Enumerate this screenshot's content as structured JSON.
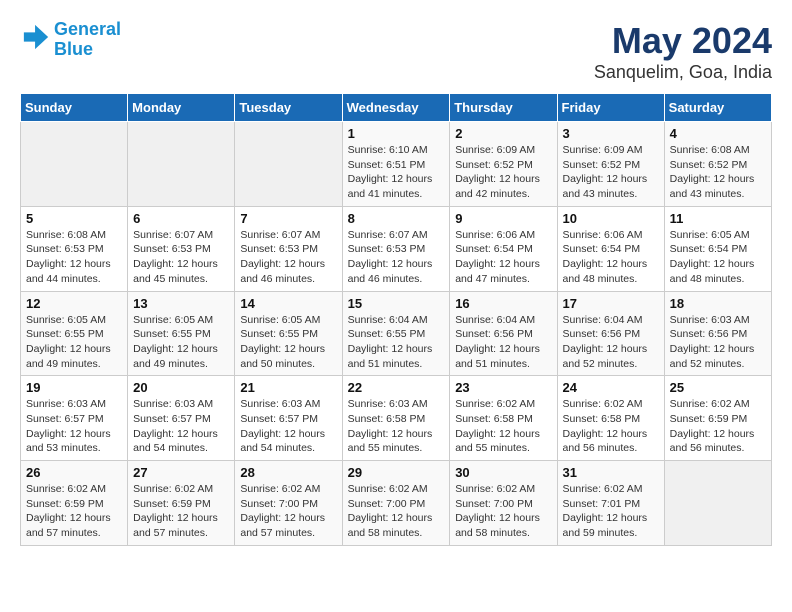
{
  "header": {
    "logo_line1": "General",
    "logo_line2": "Blue",
    "title": "May 2024",
    "subtitle": "Sanquelim, Goa, India"
  },
  "weekdays": [
    "Sunday",
    "Monday",
    "Tuesday",
    "Wednesday",
    "Thursday",
    "Friday",
    "Saturday"
  ],
  "weeks": [
    [
      {
        "day": "",
        "info": ""
      },
      {
        "day": "",
        "info": ""
      },
      {
        "day": "",
        "info": ""
      },
      {
        "day": "1",
        "info": "Sunrise: 6:10 AM\nSunset: 6:51 PM\nDaylight: 12 hours\nand 41 minutes."
      },
      {
        "day": "2",
        "info": "Sunrise: 6:09 AM\nSunset: 6:52 PM\nDaylight: 12 hours\nand 42 minutes."
      },
      {
        "day": "3",
        "info": "Sunrise: 6:09 AM\nSunset: 6:52 PM\nDaylight: 12 hours\nand 43 minutes."
      },
      {
        "day": "4",
        "info": "Sunrise: 6:08 AM\nSunset: 6:52 PM\nDaylight: 12 hours\nand 43 minutes."
      }
    ],
    [
      {
        "day": "5",
        "info": "Sunrise: 6:08 AM\nSunset: 6:53 PM\nDaylight: 12 hours\nand 44 minutes."
      },
      {
        "day": "6",
        "info": "Sunrise: 6:07 AM\nSunset: 6:53 PM\nDaylight: 12 hours\nand 45 minutes."
      },
      {
        "day": "7",
        "info": "Sunrise: 6:07 AM\nSunset: 6:53 PM\nDaylight: 12 hours\nand 46 minutes."
      },
      {
        "day": "8",
        "info": "Sunrise: 6:07 AM\nSunset: 6:53 PM\nDaylight: 12 hours\nand 46 minutes."
      },
      {
        "day": "9",
        "info": "Sunrise: 6:06 AM\nSunset: 6:54 PM\nDaylight: 12 hours\nand 47 minutes."
      },
      {
        "day": "10",
        "info": "Sunrise: 6:06 AM\nSunset: 6:54 PM\nDaylight: 12 hours\nand 48 minutes."
      },
      {
        "day": "11",
        "info": "Sunrise: 6:05 AM\nSunset: 6:54 PM\nDaylight: 12 hours\nand 48 minutes."
      }
    ],
    [
      {
        "day": "12",
        "info": "Sunrise: 6:05 AM\nSunset: 6:55 PM\nDaylight: 12 hours\nand 49 minutes."
      },
      {
        "day": "13",
        "info": "Sunrise: 6:05 AM\nSunset: 6:55 PM\nDaylight: 12 hours\nand 49 minutes."
      },
      {
        "day": "14",
        "info": "Sunrise: 6:05 AM\nSunset: 6:55 PM\nDaylight: 12 hours\nand 50 minutes."
      },
      {
        "day": "15",
        "info": "Sunrise: 6:04 AM\nSunset: 6:55 PM\nDaylight: 12 hours\nand 51 minutes."
      },
      {
        "day": "16",
        "info": "Sunrise: 6:04 AM\nSunset: 6:56 PM\nDaylight: 12 hours\nand 51 minutes."
      },
      {
        "day": "17",
        "info": "Sunrise: 6:04 AM\nSunset: 6:56 PM\nDaylight: 12 hours\nand 52 minutes."
      },
      {
        "day": "18",
        "info": "Sunrise: 6:03 AM\nSunset: 6:56 PM\nDaylight: 12 hours\nand 52 minutes."
      }
    ],
    [
      {
        "day": "19",
        "info": "Sunrise: 6:03 AM\nSunset: 6:57 PM\nDaylight: 12 hours\nand 53 minutes."
      },
      {
        "day": "20",
        "info": "Sunrise: 6:03 AM\nSunset: 6:57 PM\nDaylight: 12 hours\nand 54 minutes."
      },
      {
        "day": "21",
        "info": "Sunrise: 6:03 AM\nSunset: 6:57 PM\nDaylight: 12 hours\nand 54 minutes."
      },
      {
        "day": "22",
        "info": "Sunrise: 6:03 AM\nSunset: 6:58 PM\nDaylight: 12 hours\nand 55 minutes."
      },
      {
        "day": "23",
        "info": "Sunrise: 6:02 AM\nSunset: 6:58 PM\nDaylight: 12 hours\nand 55 minutes."
      },
      {
        "day": "24",
        "info": "Sunrise: 6:02 AM\nSunset: 6:58 PM\nDaylight: 12 hours\nand 56 minutes."
      },
      {
        "day": "25",
        "info": "Sunrise: 6:02 AM\nSunset: 6:59 PM\nDaylight: 12 hours\nand 56 minutes."
      }
    ],
    [
      {
        "day": "26",
        "info": "Sunrise: 6:02 AM\nSunset: 6:59 PM\nDaylight: 12 hours\nand 57 minutes."
      },
      {
        "day": "27",
        "info": "Sunrise: 6:02 AM\nSunset: 6:59 PM\nDaylight: 12 hours\nand 57 minutes."
      },
      {
        "day": "28",
        "info": "Sunrise: 6:02 AM\nSunset: 7:00 PM\nDaylight: 12 hours\nand 57 minutes."
      },
      {
        "day": "29",
        "info": "Sunrise: 6:02 AM\nSunset: 7:00 PM\nDaylight: 12 hours\nand 58 minutes."
      },
      {
        "day": "30",
        "info": "Sunrise: 6:02 AM\nSunset: 7:00 PM\nDaylight: 12 hours\nand 58 minutes."
      },
      {
        "day": "31",
        "info": "Sunrise: 6:02 AM\nSunset: 7:01 PM\nDaylight: 12 hours\nand 59 minutes."
      },
      {
        "day": "",
        "info": ""
      }
    ]
  ]
}
